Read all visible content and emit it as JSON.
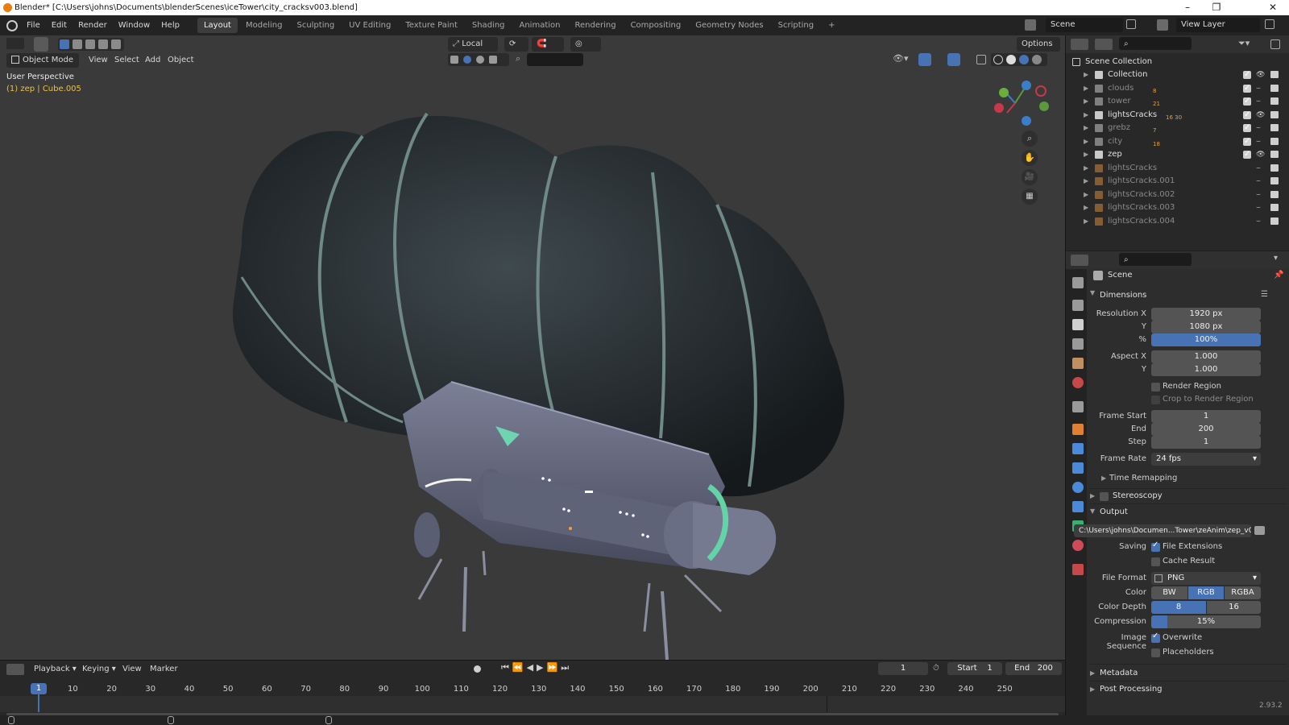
{
  "title": "Blender* [C:\\Users\\johns\\Documents\\blenderScenes\\iceTower\\city_cracksv003.blend]",
  "menus": [
    "File",
    "Edit",
    "Render",
    "Window",
    "Help"
  ],
  "workspaces": [
    "Layout",
    "Modeling",
    "Sculpting",
    "UV Editing",
    "Texture Paint",
    "Shading",
    "Animation",
    "Rendering",
    "Compositing",
    "Geometry Nodes",
    "Scripting"
  ],
  "scene_name": "Scene",
  "view_layer": "View Layer",
  "viewport": {
    "mode": "Object Mode",
    "menus": [
      "View",
      "Select",
      "Add",
      "Object"
    ],
    "transform_orientation": "Local",
    "options_label": "Options",
    "perspective_label": "User Perspective",
    "object_info": "(1) zep | Cube.005"
  },
  "outliner": {
    "root": "Scene Collection",
    "items": [
      {
        "name": "Collection",
        "badge": "",
        "active": true
      },
      {
        "name": "clouds",
        "badge": "8",
        "active": false
      },
      {
        "name": "tower",
        "badge": "21",
        "active": false
      },
      {
        "name": "lightsCracks",
        "badge": "16 30",
        "active": true
      },
      {
        "name": "grebz",
        "badge": "7",
        "active": false
      },
      {
        "name": "city",
        "badge": "18",
        "active": false
      },
      {
        "name": "zep",
        "badge": "",
        "active": true
      },
      {
        "name": "lightsCracks",
        "badge": "",
        "active": false
      },
      {
        "name": "lightsCracks.001",
        "badge": "",
        "active": false
      },
      {
        "name": "lightsCracks.002",
        "badge": "",
        "active": false
      },
      {
        "name": "lightsCracks.003",
        "badge": "",
        "active": false
      },
      {
        "name": "lightsCracks.004",
        "badge": "",
        "active": false
      }
    ]
  },
  "properties": {
    "context": "Scene",
    "dimensions": {
      "title": "Dimensions",
      "res_x_label": "Resolution X",
      "res_x": "1920 px",
      "res_y_label": "Y",
      "res_y": "1080 px",
      "pct_label": "%",
      "pct": "100%",
      "aspect_x_label": "Aspect X",
      "aspect_x": "1.000",
      "aspect_y_label": "Y",
      "aspect_y": "1.000",
      "render_region": "Render Region",
      "crop_region": "Crop to Render Region",
      "frame_start_label": "Frame Start",
      "frame_start": "1",
      "end_label": "End",
      "end": "200",
      "step_label": "Step",
      "step": "1",
      "frame_rate_label": "Frame Rate",
      "frame_rate": "24 fps",
      "time_remapping": "Time Remapping"
    },
    "stereoscopy": "Stereoscopy",
    "output": {
      "title": "Output",
      "path": "C:\\Users\\johns\\Documen...Tower\\zeAnim\\zep_v001_",
      "saving_label": "Saving",
      "file_extensions": "File Extensions",
      "cache_result": "Cache Result",
      "file_format_label": "File Format",
      "file_format": "PNG",
      "color_label": "Color",
      "color_options": [
        "BW",
        "RGB",
        "RGBA"
      ],
      "color_selected": "RGB",
      "depth_label": "Color Depth",
      "depth_options": [
        "8",
        "16"
      ],
      "depth_selected": "8",
      "compression_label": "Compression",
      "compression": "15%",
      "compression_value": 0.15,
      "image_sequence_label": "Image Sequence",
      "overwrite": "Overwrite",
      "placeholders": "Placeholders"
    },
    "metadata": "Metadata",
    "post_processing": "Post Processing"
  },
  "timeline": {
    "menus": [
      "Playback",
      "Keying",
      "View",
      "Marker"
    ],
    "current_frame": "1",
    "start_label": "Start",
    "start": "1",
    "end_label": "End",
    "end": "200",
    "ticks": [
      "1",
      "10",
      "20",
      "30",
      "40",
      "50",
      "60",
      "70",
      "80",
      "90",
      "100",
      "110",
      "120",
      "130",
      "140",
      "150",
      "160",
      "170",
      "180",
      "190",
      "200",
      "210",
      "220",
      "230",
      "240",
      "250"
    ]
  },
  "version": "2.93.2",
  "colors": {
    "accent": "#4772b3",
    "bg": "#3a3a3a",
    "panel": "#2d2d2d"
  }
}
